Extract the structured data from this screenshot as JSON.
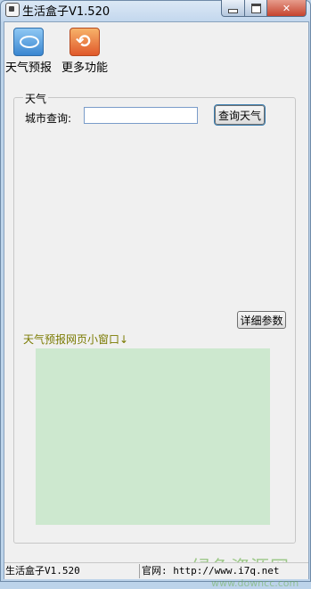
{
  "window": {
    "title": "生活盒子V1.520"
  },
  "toolbar": {
    "weather": {
      "label": "天气预报",
      "icon": "weather-icon"
    },
    "more": {
      "label": "更多功能",
      "icon": "refresh-icon"
    }
  },
  "weather_group": {
    "title": "天气",
    "city_label": "城市查询:",
    "city_value": "",
    "query_button": "查询天气",
    "detail_button": "详细参数",
    "mini_window_label": "天气预报网页小窗口↓"
  },
  "statusbar": {
    "left": "生活盒子V1.520",
    "right": "官网: http://www.i7q.net"
  },
  "watermark": {
    "text": "绿色资源网",
    "sub": "www.downcc.com"
  },
  "colors": {
    "browser_pane": "#cde8cf",
    "mini_label": "#7a7a00"
  }
}
